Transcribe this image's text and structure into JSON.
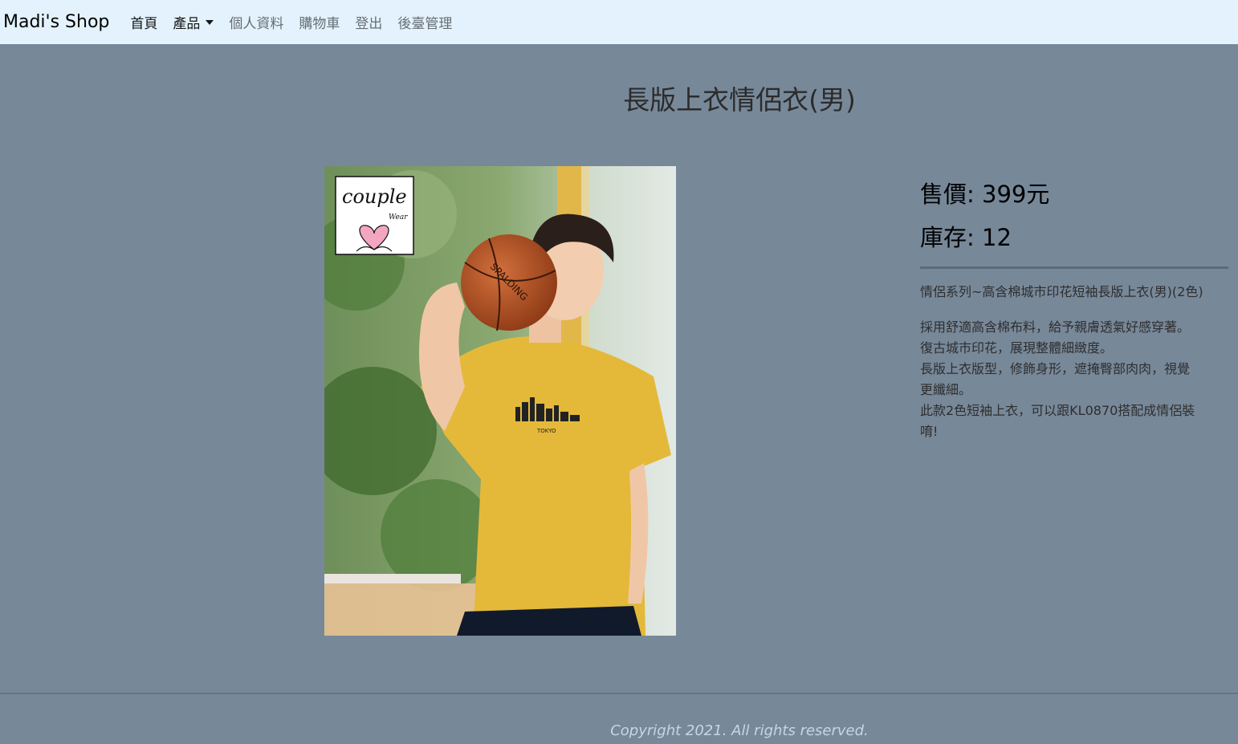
{
  "nav": {
    "brand": "Madi's Shop",
    "items": [
      {
        "label": "首頁",
        "active": true
      },
      {
        "label": "產品",
        "active": true,
        "dropdown": true
      },
      {
        "label": "個人資料",
        "active": false
      },
      {
        "label": "購物車",
        "active": false
      },
      {
        "label": "登出",
        "active": false
      },
      {
        "label": "後臺管理",
        "active": false
      }
    ]
  },
  "product": {
    "title": "長版上衣情侶衣(男)",
    "price_label": "售價: 399元",
    "stock_label": "庫存: 12",
    "subtitle": "情侶系列~高含棉城市印花短袖長版上衣(男)(2色)",
    "description": [
      "採用舒適高含棉布料，給予親膚透氣好感穿著。",
      "復古城市印花，展現整體細緻度。",
      "長版上衣版型，修飾身形，遮掩臀部肉肉，視覺",
      "更纖細。",
      "此款2色短袖上衣，可以跟KL0870搭配成情侶裝",
      "唷!"
    ],
    "logo_text": "couple",
    "logo_subtext": "Wear",
    "ball_text": "SPALDING",
    "shirt_print": "TOKYO"
  },
  "footer": {
    "copyright": "Copyright 2021. All rights reserved."
  }
}
